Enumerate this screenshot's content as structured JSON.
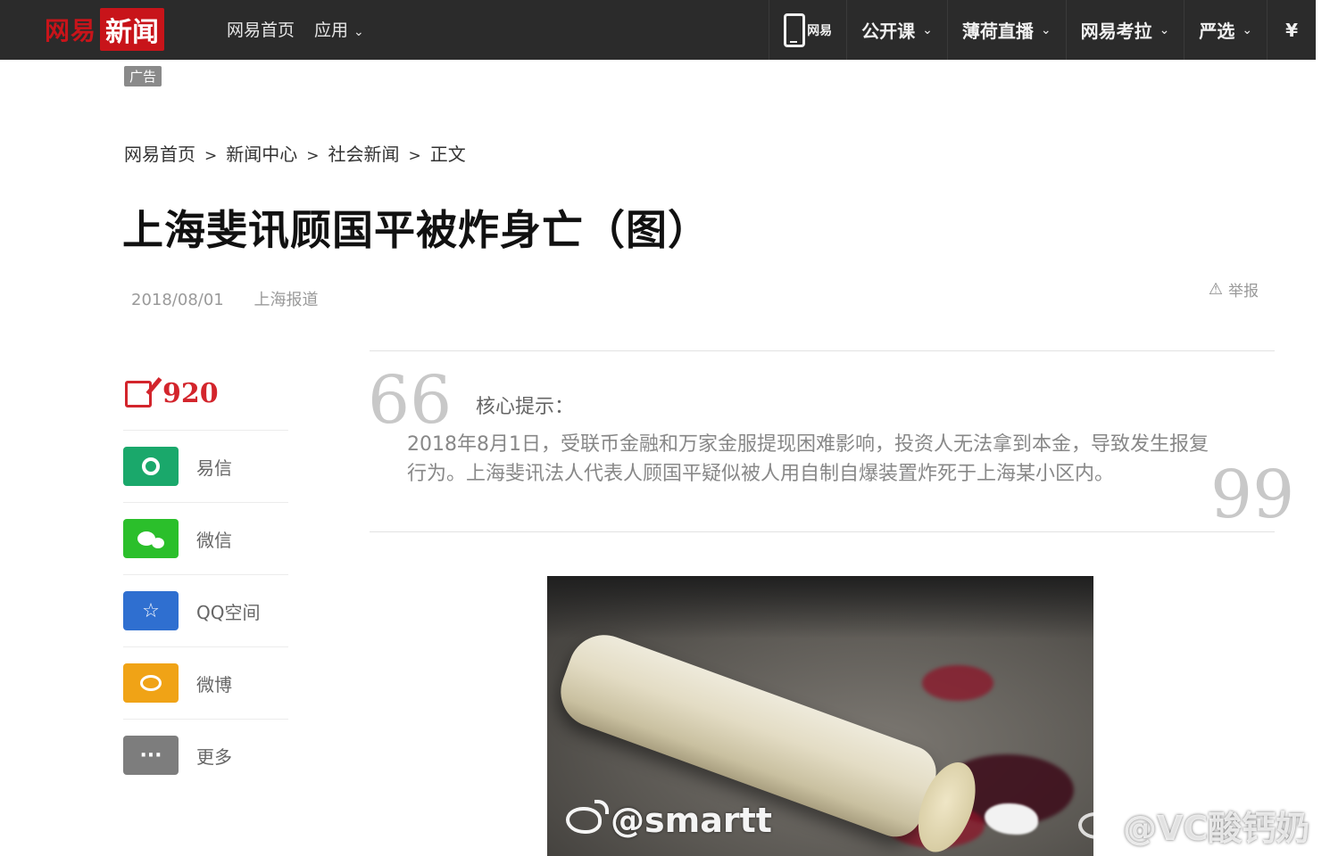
{
  "topbar": {
    "logo_brand": "网易",
    "logo_news": "新闻",
    "nav_home": "网易首页",
    "nav_apps": "应用",
    "right_items": [
      {
        "label": "网易"
      },
      {
        "label": "公开课"
      },
      {
        "label": "薄荷直播"
      },
      {
        "label": "网易考拉"
      },
      {
        "label": "严选"
      }
    ],
    "yen_symbol": "¥"
  },
  "ad_badge": "广告",
  "breadcrumb": [
    "网易首页",
    "新闻中心",
    "社会新闻",
    "正文"
  ],
  "breadcrumb_sep": ">",
  "article": {
    "title": "上海斐讯顾国平被炸身亡（图）",
    "date": "2018/08/01",
    "source": "上海报道",
    "report_label": "举报",
    "core_tip_label": "核心提示：",
    "core_tip_text": "2018年8月1日，受联币金融和万家金服提现困难影响，投资人无法拿到本金，导致发生报复行为。上海斐讯法人代表人顾国平疑似被人用自制自爆装置炸死于上海某小区内。",
    "quote_open": "66",
    "quote_close": "99"
  },
  "share": {
    "comment_count": "920",
    "items": [
      {
        "label": "易信",
        "color": "#1aa86b",
        "glyph": "O"
      },
      {
        "label": "微信",
        "color": "#2bbf2b",
        "glyph": "●●"
      },
      {
        "label": "QQ空间",
        "color": "#2f6fd0",
        "glyph": "☆"
      },
      {
        "label": "微博",
        "color": "#f0a316",
        "glyph": "◎"
      },
      {
        "label": "更多",
        "color": "#7d7d7d",
        "glyph": "···"
      }
    ]
  },
  "watermarks": [
    "@smartt",
    "@VC酸钙奶"
  ]
}
